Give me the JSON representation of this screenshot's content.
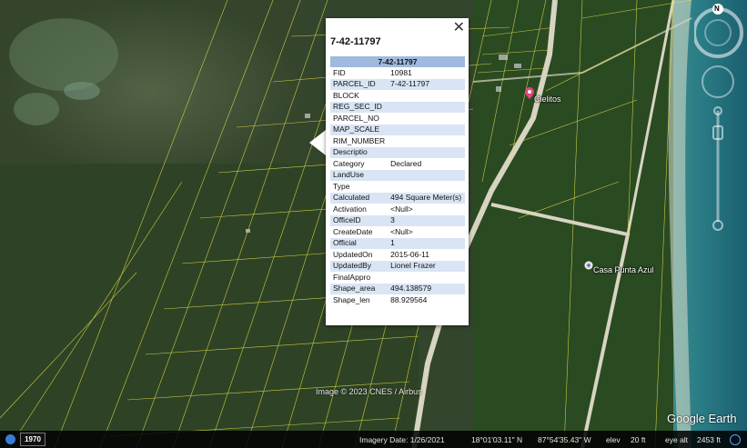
{
  "popup": {
    "close_glyph": "✕",
    "title": "7-42-11797",
    "table_header": "7-42-11797",
    "rows": [
      {
        "key": "FID",
        "value": "10981"
      },
      {
        "key": "PARCEL_ID",
        "value": "7-42-11797"
      },
      {
        "key": "BLOCK",
        "value": ""
      },
      {
        "key": "REG_SEC_ID",
        "value": ""
      },
      {
        "key": "PARCEL_NO",
        "value": ""
      },
      {
        "key": "MAP_SCALE",
        "value": ""
      },
      {
        "key": "RIM_NUMBER",
        "value": ""
      },
      {
        "key": "Descriptio",
        "value": ""
      },
      {
        "key": "Category",
        "value": "Declared"
      },
      {
        "key": "LandUse",
        "value": ""
      },
      {
        "key": "Type",
        "value": ""
      },
      {
        "key": "Calculated",
        "value": "494 Square Meter(s)"
      },
      {
        "key": "Activation",
        "value": "<Null>"
      },
      {
        "key": "OfficeID",
        "value": "3"
      },
      {
        "key": "CreateDate",
        "value": "<Null>"
      },
      {
        "key": "Official",
        "value": "1"
      },
      {
        "key": "UpdatedOn",
        "value": "2015-06-11"
      },
      {
        "key": "UpdatedBy",
        "value": "Lionel Frazer"
      },
      {
        "key": "FinalAppro",
        "value": ""
      },
      {
        "key": "Shape_area",
        "value": "494.138579"
      },
      {
        "key": "Shape_len",
        "value": "88.929564"
      }
    ]
  },
  "places": {
    "cielitos": "Cielitos",
    "casa": "Casa Punta Azul"
  },
  "map": {
    "credit": "Image © 2023 CNES / Airbus",
    "brand": "Google Earth",
    "compass_letter": "N"
  },
  "status": {
    "year": "1970",
    "imagery_date": "Imagery Date: 1/26/2021",
    "lat": "18°01'03.11\" N",
    "lon": "87°54'35.43\" W",
    "elev_label": "elev",
    "elev": "20 ft",
    "eye_alt_label": "eye alt",
    "eye_alt": "2453 ft"
  },
  "colors": {
    "parcel_line": "#e6e04a",
    "header_blue": "#9fb9df",
    "row_alt": "#d9e5f4",
    "pin_pink": "#e0457b"
  }
}
